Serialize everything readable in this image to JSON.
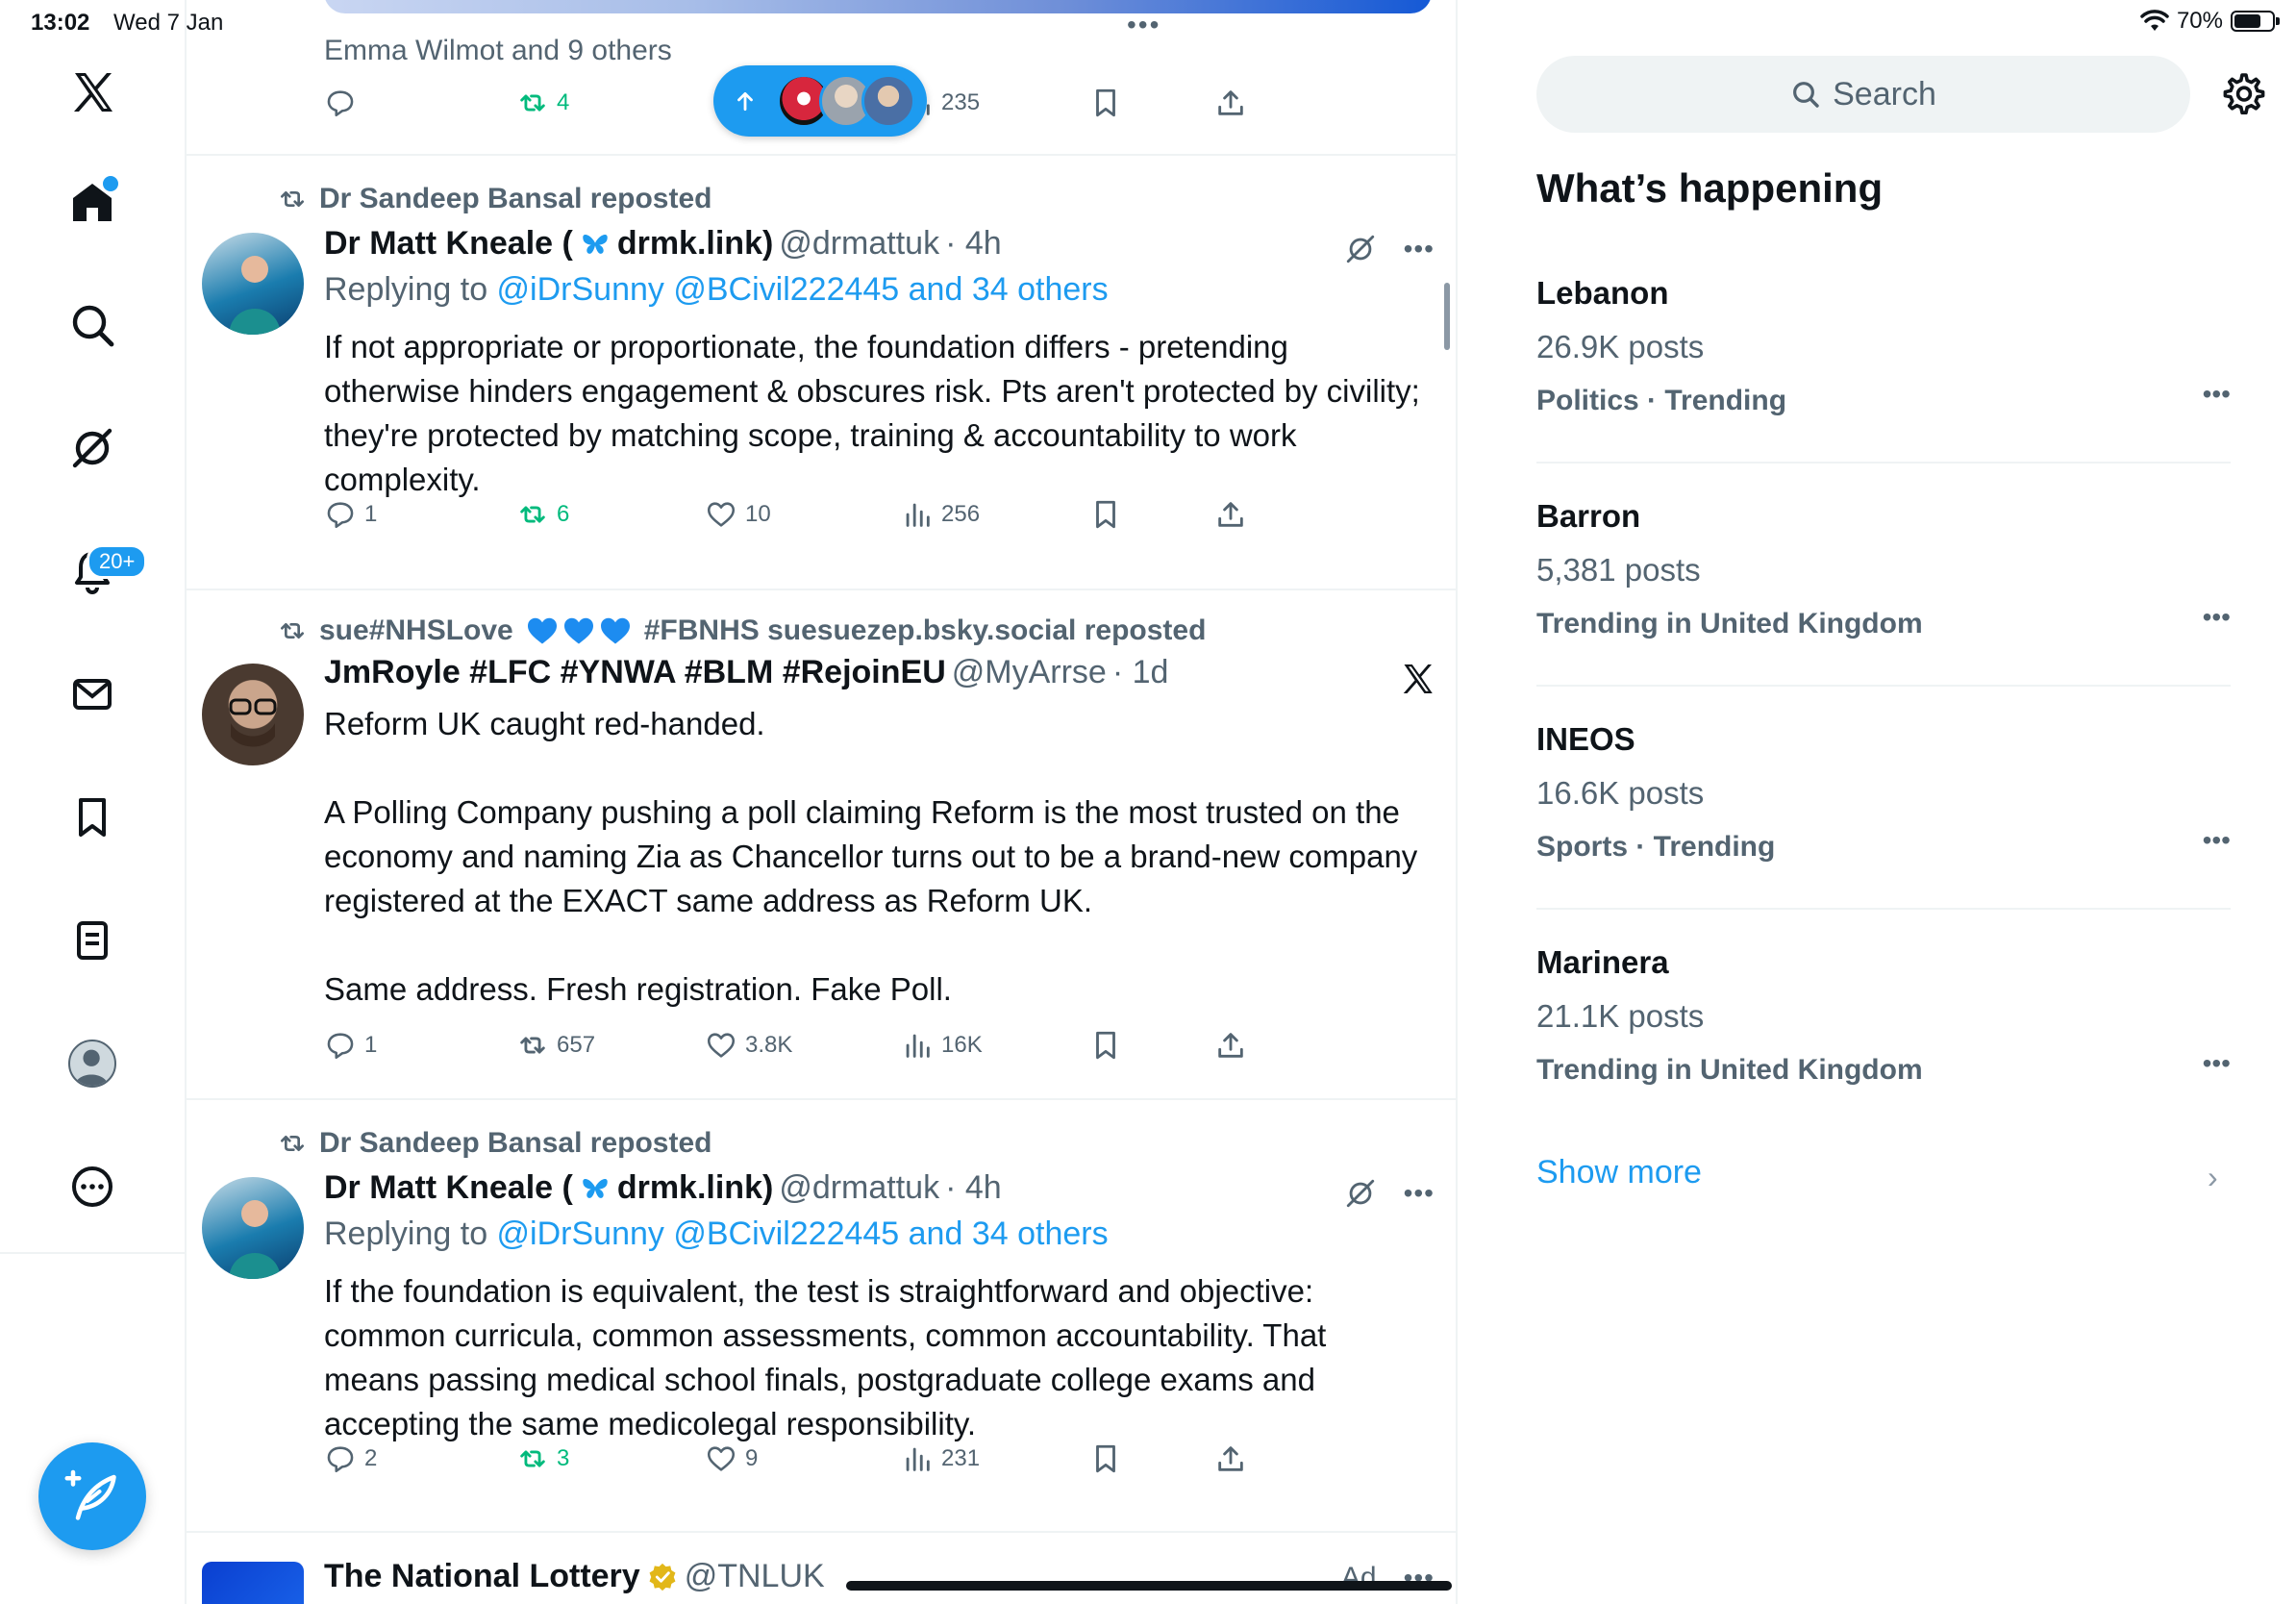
{
  "status_bar": {
    "time": "13:02",
    "date": "Wed 7 Jan",
    "battery": "70%",
    "battery_level": 0.7
  },
  "nav": {
    "items": [
      "x-logo-icon",
      "home-icon",
      "search-icon",
      "grok-icon",
      "notifications-icon",
      "messages-icon",
      "bookmarks-icon",
      "lists-icon",
      "profile-icon",
      "more-icon"
    ],
    "notifications_badge": "20+"
  },
  "feed": {
    "top_post": {
      "liked_by": "Emma Wilmot and 9 others",
      "retweets": "4",
      "views": "235"
    },
    "posts": [
      {
        "reposted_by": "Dr Sandeep Bansal reposted",
        "name_a": "Dr Matt Kneale (",
        "name_b": "drmk.link)",
        "handle": "@drmattuk",
        "time": "· 4h",
        "replying_prefix": "Replying to ",
        "replying_links": "@iDrSunny @BCivil222445 and 34 others",
        "text": "If not appropriate or proportionate, the foundation differs - pretending otherwise hinders engagement & obscures risk. Pts aren't protected by civility; they're protected by matching scope, training & accountability to work complexity.",
        "replies": "1",
        "retweets": "6",
        "likes": "10",
        "views": "256"
      },
      {
        "reposted_by": "sue#NHSLove",
        "reposted_by_b": "#FBNHS suesuezep.bsky.social reposted",
        "name": "JmRoyle #LFC #YNWA #BLM #RejoinEU",
        "handle": "@MyArrse",
        "time": "· 1d",
        "text": "Reform UK caught red-handed.\n\nA Polling Company pushing a poll claiming Reform is the most trusted on the economy and naming Zia as Chancellor turns out to be a brand-new company registered at the EXACT same address as Reform UK.\n\nSame address. Fresh registration. Fake Poll.",
        "replies": "1",
        "retweets": "657",
        "likes": "3.8K",
        "views": "16K"
      },
      {
        "reposted_by": "Dr Sandeep Bansal reposted",
        "name_a": "Dr Matt Kneale (",
        "name_b": "drmk.link)",
        "handle": "@drmattuk",
        "time": "· 4h",
        "replying_prefix": "Replying to ",
        "replying_links": "@iDrSunny @BCivil222445 and 34 others",
        "text": "If the foundation is equivalent, the test is straightforward and objective: common curricula, common assessments, common accountability. That means passing medical school finals, postgraduate college exams and accepting the same medicolegal responsibility.",
        "replies": "2",
        "retweets": "3",
        "likes": "9",
        "views": "231"
      }
    ],
    "ad_post": {
      "name": "The National Lottery",
      "handle": "@TNLUK",
      "ad_label": "Ad"
    }
  },
  "sidebar": {
    "search_placeholder": "Search",
    "title": "What’s happening",
    "trends": [
      {
        "name": "Lebanon",
        "posts": "26.9K posts",
        "category": "Politics · Trending"
      },
      {
        "name": "Barron",
        "posts": "5,381 posts",
        "category": "Trending in United Kingdom"
      },
      {
        "name": "INEOS",
        "posts": "16.6K posts",
        "category": "Sports · Trending"
      },
      {
        "name": "Marinera",
        "posts": "21.1K posts",
        "category": "Trending in United Kingdom"
      }
    ],
    "show_more": "Show more"
  },
  "colors": {
    "accent": "#1d9bf0",
    "retweet_green": "#00ba7c",
    "secondary_text": "#536471"
  }
}
